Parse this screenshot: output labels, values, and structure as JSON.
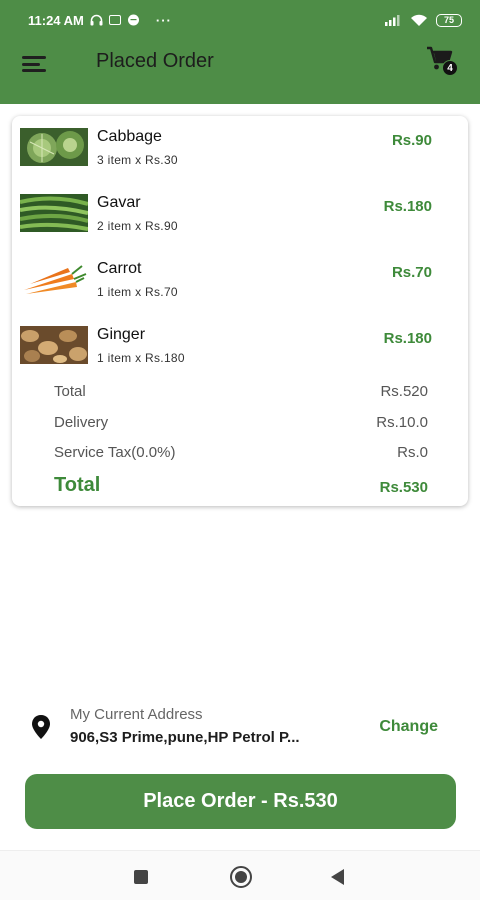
{
  "status_bar": {
    "time": "11:24 AM",
    "dots": "···",
    "battery": "75"
  },
  "app_bar": {
    "title": "Placed Order",
    "cart_count": "4"
  },
  "order": {
    "items": [
      {
        "name": "Cabbage",
        "qty": "3 item x Rs.30",
        "price": "Rs.90"
      },
      {
        "name": "Gavar",
        "qty": "2 item x Rs.90",
        "price": "Rs.180"
      },
      {
        "name": "Carrot",
        "qty": "1 item x Rs.70",
        "price": "Rs.70"
      },
      {
        "name": "Ginger",
        "qty": "1 item x Rs.180",
        "price": "Rs.180"
      }
    ],
    "summary": {
      "total_label": "Total",
      "total_value": "Rs.520",
      "delivery_label": "Delivery",
      "delivery_value": "Rs.10.0",
      "tax_label": "Service Tax(0.0%)",
      "tax_value": "Rs.0",
      "grand_label": "Total",
      "grand_value": "Rs.530"
    }
  },
  "address": {
    "title": "My Current Address",
    "text": "906,S3 Prime,pune,HP Petrol P...",
    "change_label": "Change"
  },
  "place_order": {
    "label": "Place Order - Rs.530"
  },
  "colors": {
    "brand": "#4e8d47",
    "accent_text": "#3e8a3a"
  }
}
